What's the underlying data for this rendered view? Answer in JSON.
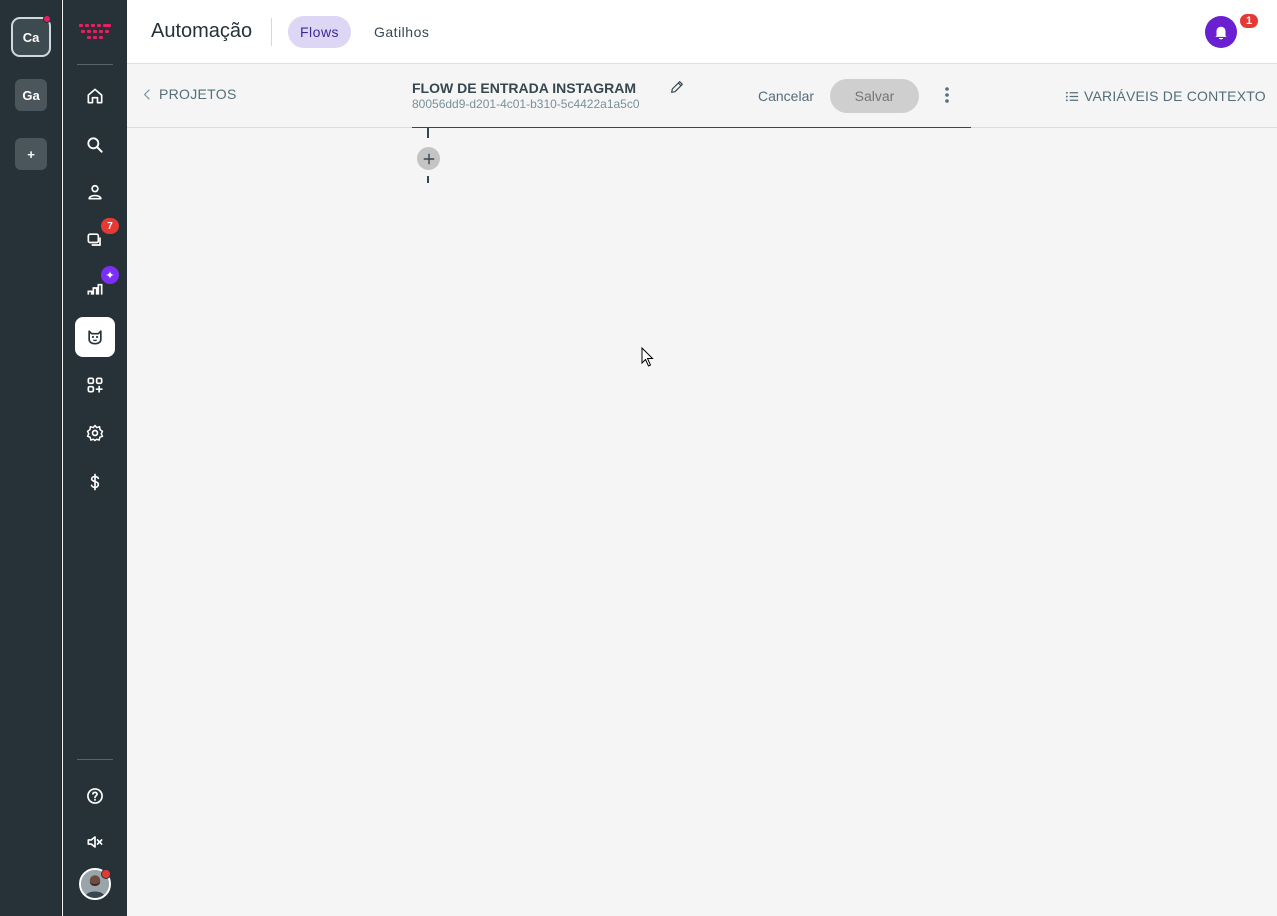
{
  "workspaces": [
    {
      "label": "Ca",
      "active": true,
      "notification": true
    },
    {
      "label": "Ga",
      "active": false
    },
    {
      "label": "+",
      "active": false
    }
  ],
  "nav": {
    "items": [
      {
        "name": "home",
        "icon": "home-icon"
      },
      {
        "name": "search",
        "icon": "search-icon"
      },
      {
        "name": "contacts",
        "icon": "person-icon"
      },
      {
        "name": "conversations",
        "icon": "chat-icon",
        "badge": "7"
      },
      {
        "name": "reports",
        "icon": "chart-icon",
        "badge": "✦"
      },
      {
        "name": "automation",
        "icon": "bot-icon",
        "active": true
      },
      {
        "name": "apps",
        "icon": "apps-icon"
      },
      {
        "name": "settings",
        "icon": "gear-icon"
      },
      {
        "name": "billing",
        "icon": "dollar-icon"
      }
    ],
    "bottom": [
      {
        "name": "help",
        "icon": "help-icon"
      },
      {
        "name": "mute",
        "icon": "mute-icon"
      }
    ]
  },
  "header": {
    "title": "Automação",
    "tabs": [
      {
        "label": "Flows",
        "active": true
      },
      {
        "label": "Gatilhos",
        "active": false
      }
    ],
    "notifications": "1"
  },
  "toolbar": {
    "back_label": "PROJETOS",
    "flow_name": "FLOW DE ENTRADA INSTAGRAM",
    "flow_id": "80056dd9-d201-4c01-b310-5c4422a1a5c0",
    "cancel_label": "Cancelar",
    "save_label": "Salvar",
    "context_vars_label": "VARIÁVEIS DE CONTEXTO"
  },
  "colors": {
    "sidebar": "#263238",
    "accent": "#6a1fd1",
    "tab_active_bg": "#ddd6f5",
    "badge": "#e53935"
  }
}
